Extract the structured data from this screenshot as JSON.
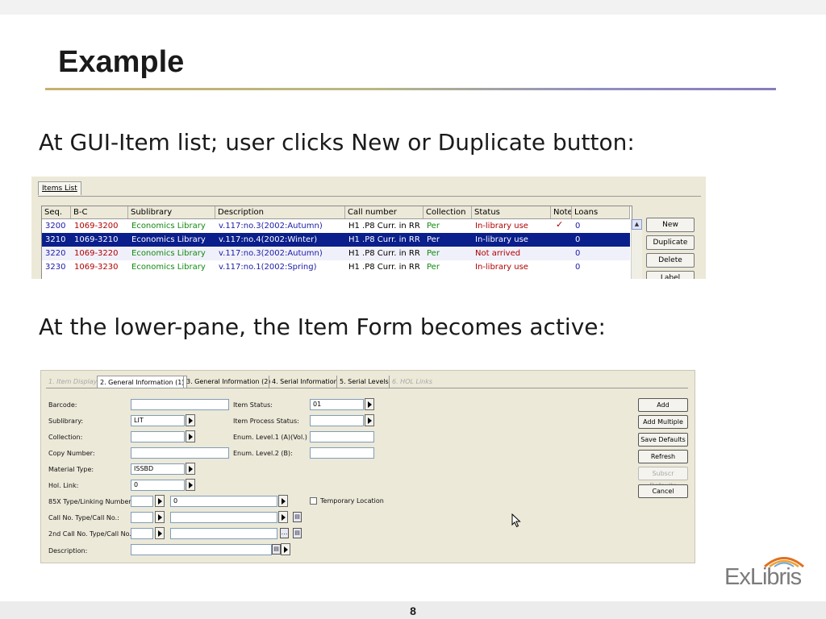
{
  "slide": {
    "title": "Example",
    "para1": "At GUI-Item list; user clicks New or Duplicate button:",
    "para2": "At the lower-pane, the Item Form becomes active:",
    "page_number": "8",
    "logo_text": "ExLibris"
  },
  "items_list": {
    "tab_label": "Items List",
    "columns": [
      "Seq.",
      "B-C",
      "Sublibrary",
      "Description",
      "Call number",
      "Collection",
      "Status",
      "Note",
      "Loans"
    ],
    "rows": [
      {
        "seq": "3200",
        "bc": "1069-3200",
        "sublibrary": "Economics Library",
        "description": "v.117:no.3(2002:Autumn)",
        "call_number": "H1 .P8 Curr. in RR",
        "collection": "Per",
        "status": "In-library use",
        "note": "✓",
        "loans": "0"
      },
      {
        "seq": "3210",
        "bc": "1069-3210",
        "sublibrary": "Economics Library",
        "description": "v.117:no.4(2002:Winter)",
        "call_number": "H1 .P8 Curr. in RR",
        "collection": "Per",
        "status": "In-library use",
        "note": "",
        "loans": "0"
      },
      {
        "seq": "3220",
        "bc": "1069-3220",
        "sublibrary": "Economics Library",
        "description": "v.117:no.3(2002:Autumn)",
        "call_number": "H1 .P8 Curr. in RR",
        "collection": "Per",
        "status": "Not arrived",
        "note": "",
        "loans": "0"
      },
      {
        "seq": "3230",
        "bc": "1069-3230",
        "sublibrary": "Economics Library",
        "description": "v.117:no.1(2002:Spring)",
        "call_number": "H1 .P8 Curr. in RR",
        "collection": "Per",
        "status": "In-library use",
        "note": "",
        "loans": "0"
      }
    ],
    "buttons": [
      "New",
      "Duplicate",
      "Delete",
      "Label"
    ]
  },
  "item_form": {
    "tabs": [
      "1. Item Display",
      "2. General Information (1)",
      "3. General Information (2)",
      "4. Serial Information",
      "5. Serial Levels",
      "6. HOL Links"
    ],
    "left_labels": {
      "barcode": "Barcode:",
      "sublibrary": "Sublibrary:",
      "collection": "Collection:",
      "copy_number": "Copy Number:",
      "material_type": "Material Type:",
      "hol_link": "Hol. Link:",
      "type_85x": "85X Type/Linking Number:",
      "call_no": "Call No. Type/Call No.:",
      "call_no_2": "2nd Call No. Type/Call No.:",
      "description": "Description:"
    },
    "left_values": {
      "sublibrary": "LIT",
      "material_type": "ISSBD",
      "hol_link": "0",
      "linking_number": "0"
    },
    "right_labels": {
      "item_status": "Item Status:",
      "item_process_status": "Item Process Status:",
      "enum1": "Enum. Level.1 (A)(Vol.)",
      "enum2": "Enum. Level.2  (B):",
      "temp_location": "Temporary Location"
    },
    "right_values": {
      "item_status": "01"
    },
    "buttons": [
      "Add",
      "Add Multiple",
      "Save Defaults",
      "Refresh",
      "Subscr Defaults",
      "Cancel"
    ]
  }
}
